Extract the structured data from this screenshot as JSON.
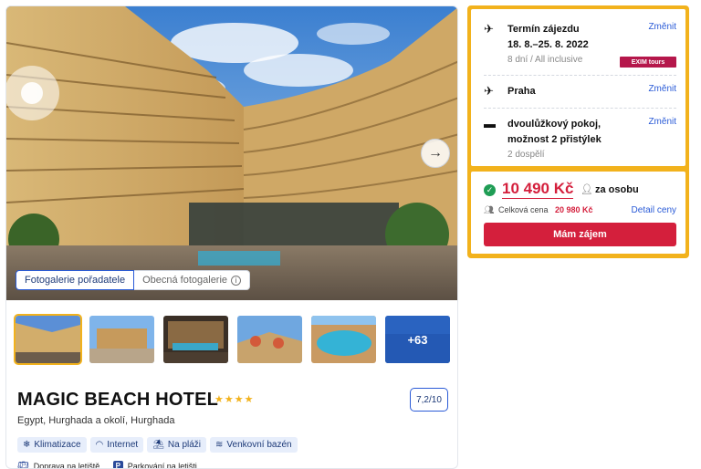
{
  "gallery": {
    "tabs": [
      "Fotogalerie pořadatele",
      "Obecná fotogalerie"
    ],
    "more_count": "+63"
  },
  "hotel": {
    "name": "MAGIC BEACH HOTEL",
    "stars": "★★★★",
    "star_count": 4,
    "rating": "7,2/10",
    "location": "Egypt, Hurghada a okolí, Hurghada",
    "amenities": [
      {
        "icon": "snowflake-icon",
        "label": "Klimatizace"
      },
      {
        "icon": "wifi-icon",
        "label": "Internet"
      },
      {
        "icon": "beach-icon",
        "label": "Na pláži"
      },
      {
        "icon": "pool-icon",
        "label": "Venkovní bazén"
      }
    ],
    "transport": [
      {
        "icon": "bus-icon",
        "label": "Doprava na letiště."
      },
      {
        "icon": "parking-icon",
        "label": "Parkování na letišti"
      }
    ]
  },
  "booking": {
    "change_label": "Změnit",
    "term": {
      "label": "Termín zájezdu",
      "dates": "18. 8.–25. 8. 2022",
      "info": "8 dní / All inclusive",
      "operator": "EXIM tours"
    },
    "departure": "Praha",
    "room": {
      "line1": "dvoulůžkový pokoj,",
      "line2": "možnost 2 přistýlek",
      "occupancy": "2 dospělí"
    },
    "price": {
      "per_person": "10 490 Kč",
      "per_person_label": "za osobu",
      "total_label": "Celková cena",
      "total": "20 980 Kč",
      "detail_label": "Detail ceny",
      "cta": "Mám zájem"
    }
  },
  "colors": {
    "accent_yellow": "#f2b21c",
    "price_red": "#d41f3c",
    "link_blue": "#2a5bd7",
    "success_green": "#1f9d55"
  }
}
